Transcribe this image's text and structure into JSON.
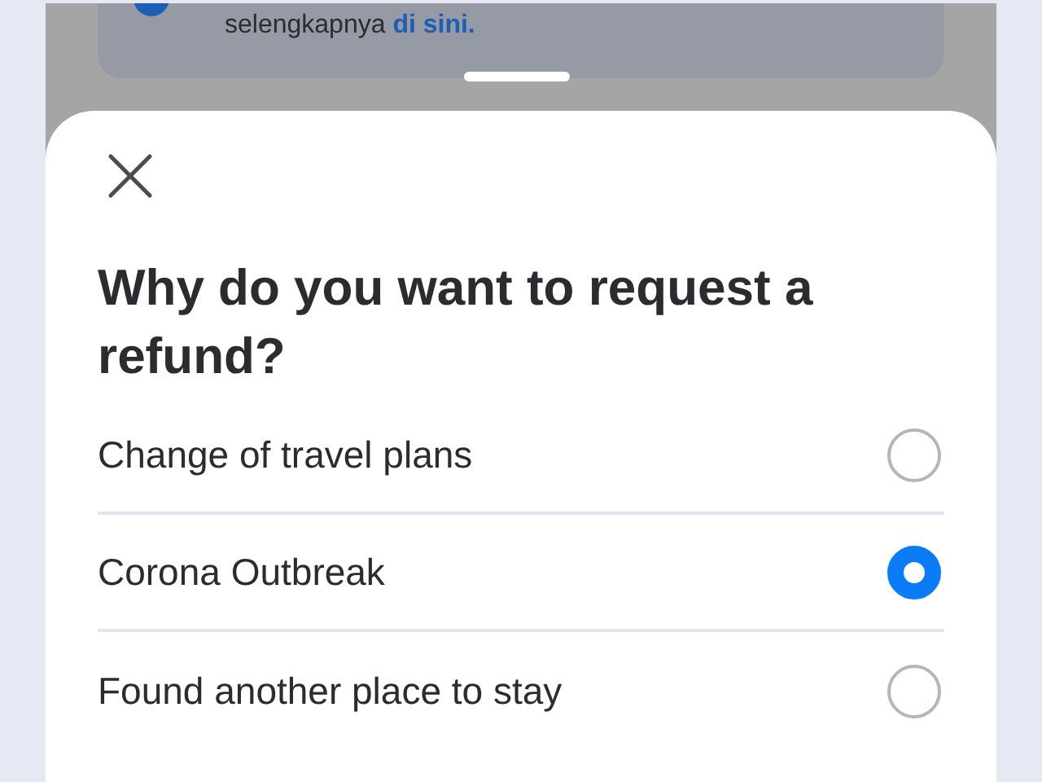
{
  "background_card": {
    "text": "selengkapnya ",
    "link": "di sini."
  },
  "sheet": {
    "title": "Why do you want to request a refund?",
    "options": [
      {
        "label": "Change of travel plans",
        "selected": false
      },
      {
        "label": "Corona Outbreak",
        "selected": true
      },
      {
        "label": "Found another place to stay",
        "selected": false
      }
    ]
  }
}
